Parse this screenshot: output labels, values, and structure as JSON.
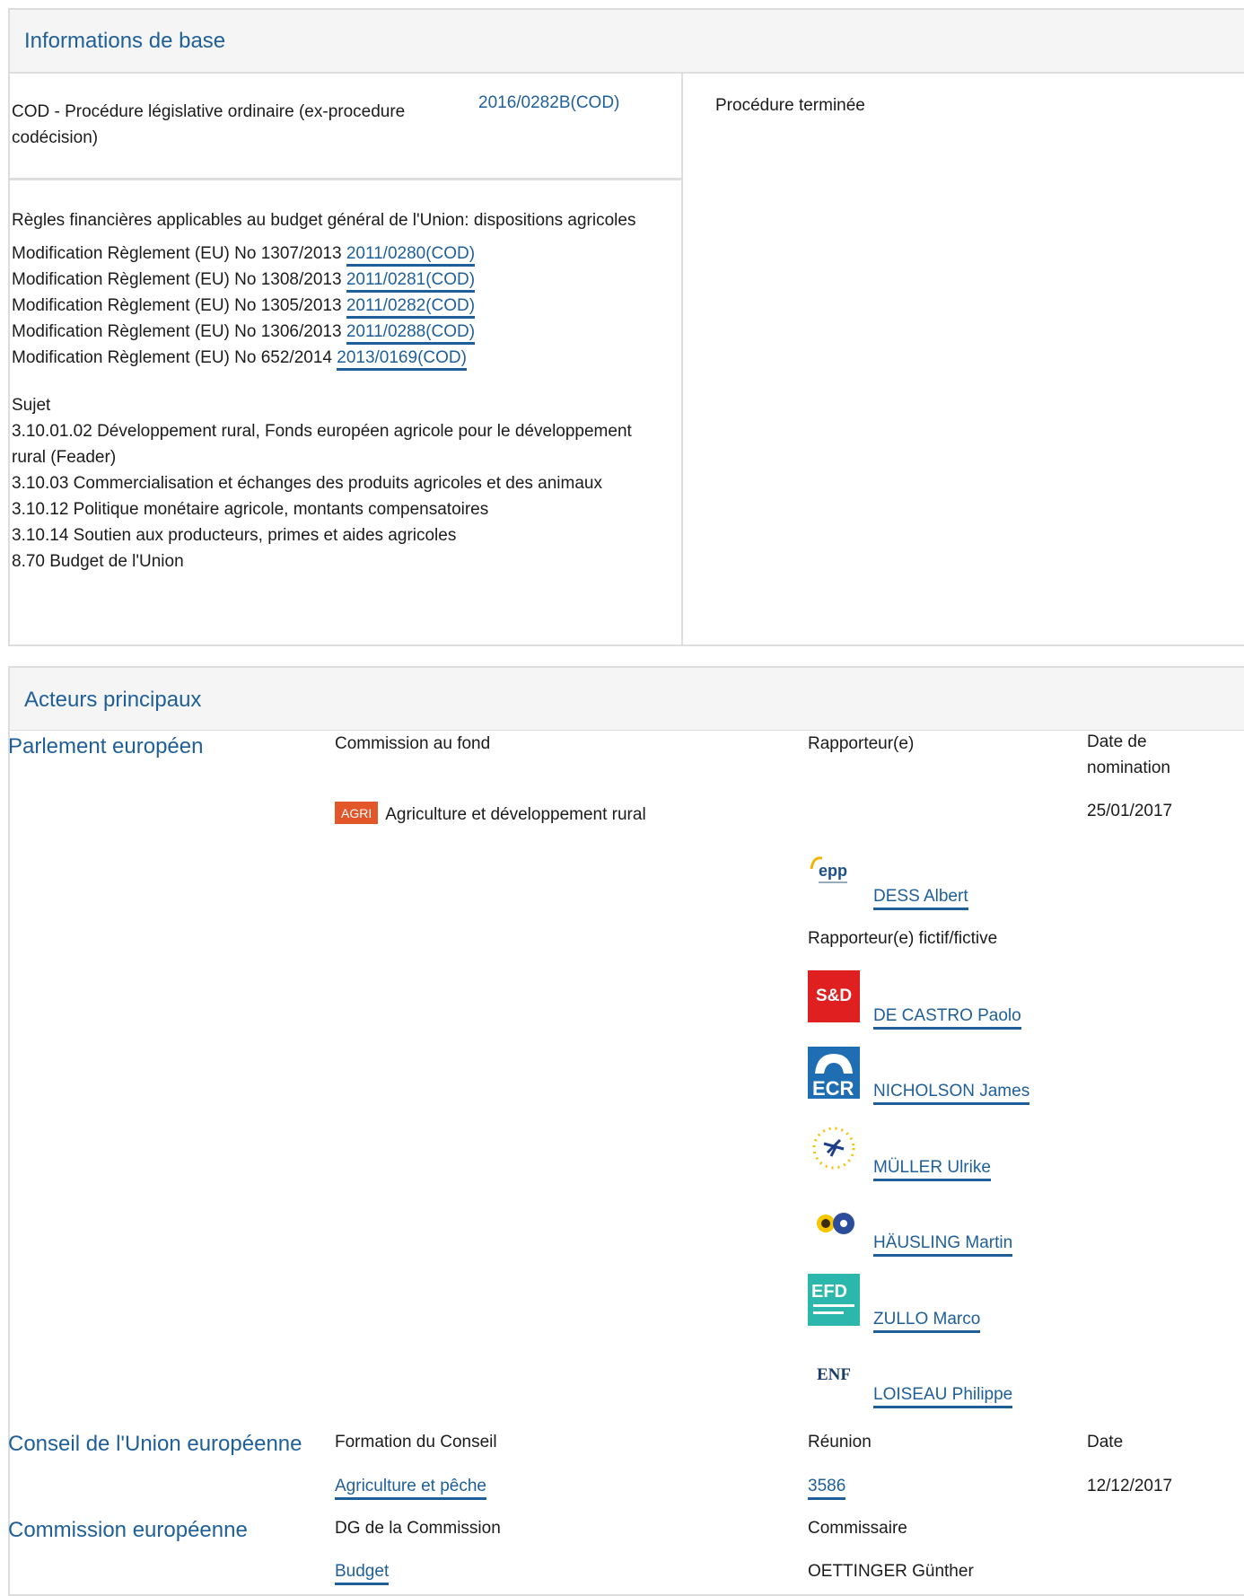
{
  "basic": {
    "heading": "Informations de base",
    "procedure_type": "COD - Procédure législative ordinaire (ex-procedure codécision)",
    "reference": "2016/0282B(COD)",
    "status": "Procédure terminée",
    "title": "Règles financières applicables au budget général de l'Union: dispositions agricoles",
    "amendments": [
      {
        "text": "Modification Règlement (EU) No 1307/2013",
        "ref": "2011/0280(COD)"
      },
      {
        "text": "Modification Règlement (EU) No 1308/2013",
        "ref": "2011/0281(COD)"
      },
      {
        "text": "Modification Règlement (EU) No 1305/2013",
        "ref": "2011/0282(COD)"
      },
      {
        "text": "Modification Règlement (EU) No 1306/2013",
        "ref": "2011/0288(COD)"
      },
      {
        "text": "Modification Règlement (EU) No 652/2014",
        "ref": "2013/0169(COD)"
      }
    ],
    "subject_label": "Sujet",
    "subjects": [
      "3.10.01.02 Développement rural, Fonds européen agricole pour le développement rural (Feader)",
      "3.10.03 Commercialisation et échanges des produits agricoles et des animaux",
      "3.10.12 Politique monétaire agricole, montants compensatoires",
      "3.10.14 Soutien aux producteurs, primes et aides agricoles",
      "8.70 Budget de l'Union"
    ]
  },
  "actors": {
    "heading": "Acteurs principaux",
    "parliament": {
      "label": "Parlement européen",
      "col_committee": "Commission au fond",
      "col_rapporteur": "Rapporteur(e)",
      "col_date": "Date de nomination",
      "committee_badge": "AGRI",
      "committee_name": "Agriculture et développement rural",
      "date": "25/01/2017",
      "rapporteur": {
        "group_logo": "epp",
        "name": "DESS Albert"
      },
      "shadow_label": "Rapporteur(e) fictif/fictive",
      "shadows": [
        {
          "group_logo": "S&D",
          "name": "DE CASTRO Paolo"
        },
        {
          "group_logo": "ECR",
          "name": "NICHOLSON James"
        },
        {
          "group_logo": "GUE/NGL",
          "name": "MÜLLER Ulrike"
        },
        {
          "group_logo": "Verts/ALE",
          "name": "HÄUSLING Martin"
        },
        {
          "group_logo": "EFDD",
          "name": "ZULLO Marco"
        },
        {
          "group_logo": "ENF",
          "name": "LOISEAU Philippe"
        }
      ]
    },
    "council": {
      "label": "Conseil de l'Union européenne",
      "col_formation": "Formation du Conseil",
      "col_meeting": "Réunion",
      "col_date": "Date",
      "formation": "Agriculture et pêche",
      "meeting": "3586",
      "date": "12/12/2017"
    },
    "commission": {
      "label": "Commission européenne",
      "col_dg": "DG de la Commission",
      "col_commissioner": "Commissaire",
      "dg": "Budget",
      "commissioner": "OETTINGER Günther"
    }
  },
  "colors": {
    "link": "#1f5f99",
    "badge": "#e2562a",
    "border": "#dddddd",
    "header_bg": "#f5f5f5"
  }
}
